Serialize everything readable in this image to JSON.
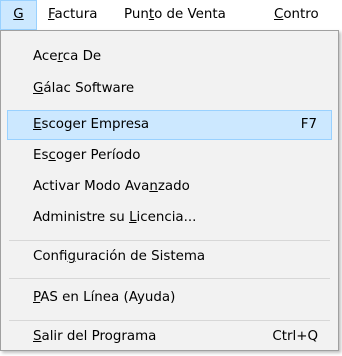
{
  "menubar": {
    "items": [
      {
        "pre": "",
        "acc": "G",
        "post": ""
      },
      {
        "pre": "",
        "acc": "F",
        "post": "actura"
      },
      {
        "pre": "Pun",
        "acc": "t",
        "post": "o de Venta"
      },
      {
        "pre": "",
        "acc": "C",
        "post": "ontro"
      }
    ]
  },
  "menu": {
    "items": [
      {
        "pre": "Ace",
        "acc": "r",
        "post": "ca De",
        "shortcut": ""
      },
      {
        "pre": "",
        "acc": "G",
        "post": "álac Software",
        "shortcut": ""
      },
      {
        "pre": "",
        "acc": "E",
        "post": "scoger Empresa",
        "shortcut": "F7"
      },
      {
        "pre": "Es",
        "acc": "c",
        "post": "oger Período",
        "shortcut": ""
      },
      {
        "pre": "Activar Modo Ava",
        "acc": "n",
        "post": "zado",
        "shortcut": ""
      },
      {
        "pre": "Administre su ",
        "acc": "L",
        "post": "icencia...",
        "shortcut": ""
      },
      {
        "pre": "Confi",
        "acc": "g",
        "post": "uración de Sistema",
        "shortcut": ""
      },
      {
        "pre": "",
        "acc": "P",
        "post": "AS en Línea (Ayuda)",
        "shortcut": ""
      },
      {
        "pre": "",
        "acc": "S",
        "post": "alir del Programa",
        "shortcut": "Ctrl+Q"
      }
    ]
  },
  "colors": {
    "highlight_bg": "#cce8ff",
    "highlight_border": "#99d1ff",
    "menu_bg": "#f2f2f2"
  }
}
